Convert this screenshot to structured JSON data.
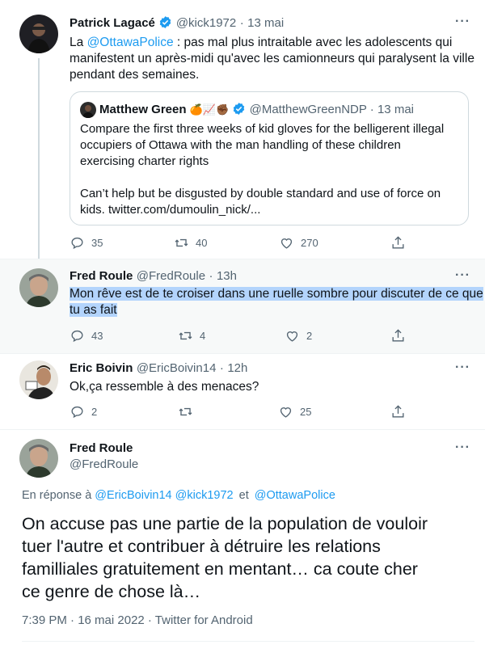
{
  "tweet1": {
    "name": "Patrick Lagacé",
    "handle": "@kick1972",
    "dot": "·",
    "time": "13 mai",
    "text_prefix": "La ",
    "text_mention": "@OttawaPolice",
    "text_rest_line1": " : pas mal plus intraitable avec les adolescents qui",
    "text_line2": "manifestent un après-midi qu'avec les camionneurs qui paralysent la ville",
    "text_line3": "pendant des semaines.",
    "quote": {
      "name": "Matthew Green",
      "emojis": "🍊📈✊🏾",
      "handle": "@MatthewGreenNDP",
      "dot": "·",
      "time": "13 mai",
      "line1": "Compare the first three weeks of kid gloves for the belligerent illegal",
      "line2": "occupiers of Ottawa with the man handling of these children",
      "line3": "exercising  charter rights",
      "line4": "Can’t help but be disgusted by double standard and use of force on",
      "line5": "kids. twitter.com/dumoulin_nick/..."
    },
    "replies": "35",
    "retweets": "40",
    "likes": "270"
  },
  "tweet2": {
    "name": "Fred Roule",
    "handle": "@FredRoule",
    "dot": "·",
    "time": "13h",
    "line1": "Mon rêve est de te croiser dans une ruelle sombre pour discuter de ce que",
    "line2": "tu as fait",
    "replies": "43",
    "retweets": "4",
    "likes": "2"
  },
  "tweet3": {
    "name": "Eric Boivin",
    "handle": "@EricBoivin14",
    "dot": "·",
    "time": "12h",
    "text": "Ok,ça ressemble à des menaces?",
    "replies": "2",
    "retweets": "",
    "likes": "25"
  },
  "main": {
    "name": "Fred Roule",
    "handle": "@FredRoule",
    "reply_prefix": "En réponse à ",
    "reply_m1": "@EricBoivin14",
    "reply_m2": "@kick1972",
    "reply_et": "et",
    "reply_m3": "@OttawaPolice",
    "line1": "On accuse pas une partie de la population de vouloir",
    "line2": "tuer l'autre et contribuer à détruire les relations",
    "line3": "familliales gratuitement en mentant… ca coute cher",
    "line4": "ce genre de chose là…",
    "timestamp": "7:39 PM · 16 mai 2022 · Twitter for Android"
  },
  "more_label": "···",
  "colors": {
    "accent": "#1d9bf0",
    "muted": "#536471",
    "text": "#0f1419",
    "highlight": "#b3d4fc",
    "thread": "#cfd9de"
  }
}
